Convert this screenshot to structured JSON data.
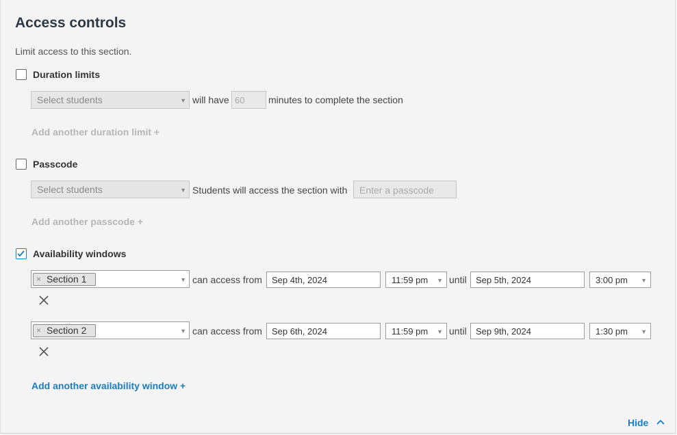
{
  "header": {
    "title": "Access controls",
    "subtitle": "Limit access to this section."
  },
  "duration": {
    "label": "Duration limits",
    "checked": false,
    "select_placeholder": "Select students",
    "will_have": "will have",
    "minutes_value": "60",
    "minutes_text": "minutes to complete the section",
    "add_link": "Add another duration limit +"
  },
  "passcode": {
    "label": "Passcode",
    "checked": false,
    "select_placeholder": "Select students",
    "access_text": "Students will access the section with",
    "passcode_placeholder": "Enter a passcode",
    "add_link": "Add another passcode +"
  },
  "availability": {
    "label": "Availability windows",
    "checked": true,
    "can_access_from": "can access from",
    "until": "until",
    "windows": [
      {
        "section": "Section 1",
        "start_date": "Sep 4th, 2024",
        "start_time": "11:59 pm",
        "end_date": "Sep 5th, 2024",
        "end_time": "3:00 pm"
      },
      {
        "section": "Section 2",
        "start_date": "Sep 6th, 2024",
        "start_time": "11:59 pm",
        "end_date": "Sep 9th, 2024",
        "end_time": "1:30 pm"
      }
    ],
    "add_link": "Add another availability window +"
  },
  "footer": {
    "hide_label": "Hide"
  },
  "icons": {
    "caret": "caret-down-icon",
    "remove": "close-icon",
    "check": "check-icon",
    "chevron": "chevron-up-icon"
  },
  "colors": {
    "accent": "#1a7cc1",
    "title": "#2d3a45",
    "disabled_text": "#b6b6b6"
  }
}
